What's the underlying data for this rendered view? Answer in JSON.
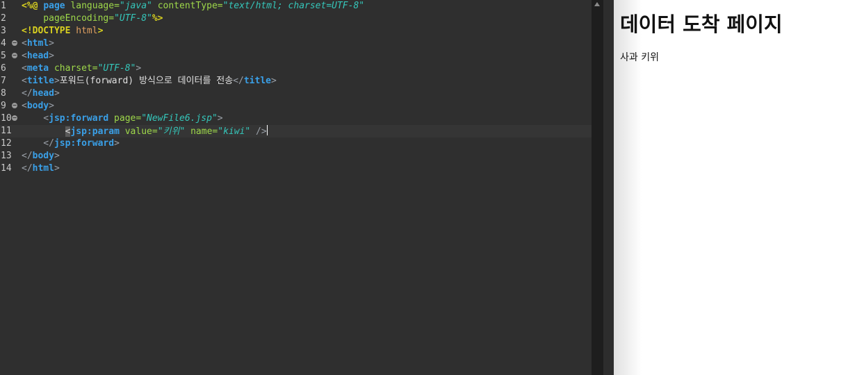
{
  "editor": {
    "lines": [
      {
        "num": "1",
        "fold": false,
        "current": false,
        "tokens": [
          {
            "t": "<%@ ",
            "c": "directive"
          },
          {
            "t": "page",
            "c": "tag"
          },
          {
            "t": " language=",
            "c": "attr"
          },
          {
            "t": "\"java\"",
            "c": "val"
          },
          {
            "t": " contentType=",
            "c": "attr"
          },
          {
            "t": "\"text/html; charset=UTF-8\"",
            "c": "val"
          }
        ]
      },
      {
        "num": "2",
        "fold": false,
        "current": false,
        "tokens": [
          {
            "t": "    pageEncoding=",
            "c": "attr"
          },
          {
            "t": "\"UTF-8\"",
            "c": "val"
          },
          {
            "t": "%>",
            "c": "directive"
          }
        ]
      },
      {
        "num": "3",
        "fold": false,
        "current": false,
        "tokens": [
          {
            "t": "<!DOCTYPE ",
            "c": "directive"
          },
          {
            "t": "html",
            "c": "doctype"
          },
          {
            "t": ">",
            "c": "directive"
          }
        ]
      },
      {
        "num": "4",
        "fold": true,
        "current": false,
        "tokens": [
          {
            "t": "<",
            "c": "br"
          },
          {
            "t": "html",
            "c": "tag"
          },
          {
            "t": ">",
            "c": "br"
          }
        ]
      },
      {
        "num": "5",
        "fold": true,
        "current": false,
        "tokens": [
          {
            "t": "<",
            "c": "br"
          },
          {
            "t": "head",
            "c": "tag"
          },
          {
            "t": ">",
            "c": "br"
          }
        ]
      },
      {
        "num": "6",
        "fold": false,
        "current": false,
        "tokens": [
          {
            "t": "<",
            "c": "br"
          },
          {
            "t": "meta",
            "c": "tag"
          },
          {
            "t": " charset=",
            "c": "attr"
          },
          {
            "t": "\"UTF-8\"",
            "c": "val"
          },
          {
            "t": ">",
            "c": "br"
          }
        ]
      },
      {
        "num": "7",
        "fold": false,
        "current": false,
        "tokens": [
          {
            "t": "<",
            "c": "br"
          },
          {
            "t": "title",
            "c": "tag"
          },
          {
            "t": ">",
            "c": "br"
          },
          {
            "t": "포워드(forward) 방식으로 데이터를 전송",
            "c": "text"
          },
          {
            "t": "</",
            "c": "br"
          },
          {
            "t": "title",
            "c": "tag"
          },
          {
            "t": ">",
            "c": "br"
          }
        ]
      },
      {
        "num": "8",
        "fold": false,
        "current": false,
        "tokens": [
          {
            "t": "</",
            "c": "br"
          },
          {
            "t": "head",
            "c": "tag"
          },
          {
            "t": ">",
            "c": "br"
          }
        ]
      },
      {
        "num": "9",
        "fold": true,
        "current": false,
        "tokens": [
          {
            "t": "<",
            "c": "br"
          },
          {
            "t": "body",
            "c": "tag"
          },
          {
            "t": ">",
            "c": "br"
          }
        ]
      },
      {
        "num": "10",
        "fold": true,
        "current": false,
        "tokens": [
          {
            "t": "    <",
            "c": "br"
          },
          {
            "t": "jsp:forward",
            "c": "tag"
          },
          {
            "t": " page=",
            "c": "attr"
          },
          {
            "t": "\"NewFile6.jsp\"",
            "c": "val"
          },
          {
            "t": ">",
            "c": "br"
          }
        ]
      },
      {
        "num": "11",
        "fold": false,
        "current": true,
        "tokens": [
          {
            "t": "        ",
            "c": "plain"
          },
          {
            "t": "<",
            "c": "hl"
          },
          {
            "t": "jsp:param",
            "c": "tag"
          },
          {
            "t": " value=",
            "c": "attr"
          },
          {
            "t": "\"키위\"",
            "c": "val"
          },
          {
            "t": " name=",
            "c": "attr"
          },
          {
            "t": "\"kiwi\"",
            "c": "val"
          },
          {
            "t": " />",
            "c": "br"
          }
        ]
      },
      {
        "num": "12",
        "fold": false,
        "current": false,
        "tokens": [
          {
            "t": "    </",
            "c": "br"
          },
          {
            "t": "jsp:forward",
            "c": "tag"
          },
          {
            "t": ">",
            "c": "br"
          }
        ]
      },
      {
        "num": "13",
        "fold": false,
        "current": false,
        "tokens": [
          {
            "t": "</",
            "c": "br"
          },
          {
            "t": "body",
            "c": "tag"
          },
          {
            "t": ">",
            "c": "br"
          }
        ]
      },
      {
        "num": "14",
        "fold": false,
        "current": false,
        "tokens": [
          {
            "t": "</",
            "c": "br"
          },
          {
            "t": "html",
            "c": "tag"
          },
          {
            "t": ">",
            "c": "br"
          }
        ]
      }
    ]
  },
  "preview": {
    "heading": "데이터 도착 페이지",
    "body_text": "사과 키위"
  },
  "colors": {
    "editor_bg": "#2f2f2f",
    "tag": "#3aa0e8",
    "attribute": "#9ed84a",
    "value": "#35c6ba",
    "directive": "#d8d020"
  }
}
